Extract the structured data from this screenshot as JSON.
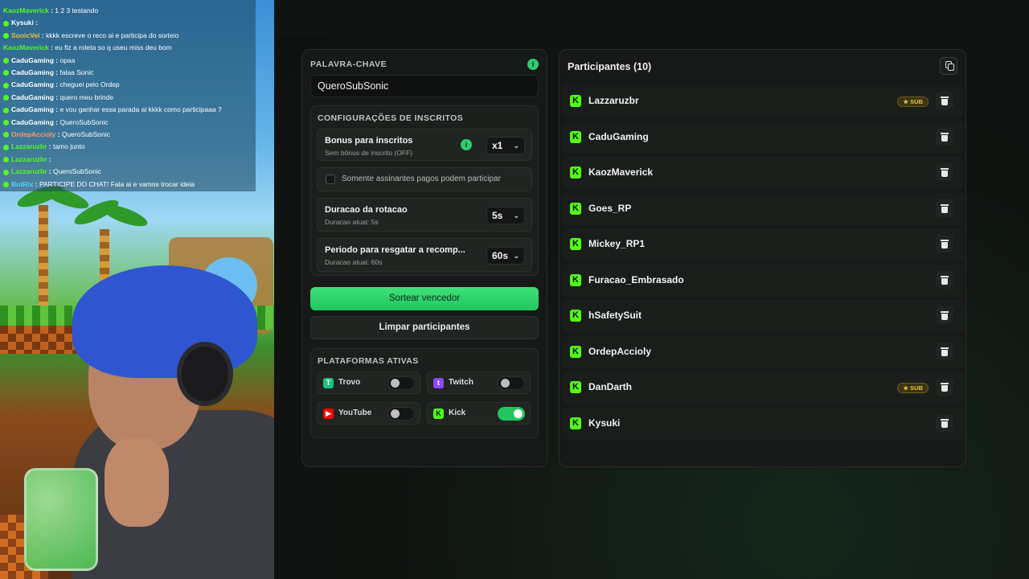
{
  "chat": {
    "lines": [
      {
        "user": "KaozMaverick",
        "message": "1 2 3 testando",
        "color": "#53fc18",
        "badge": false
      },
      {
        "user": "Kysuki",
        "message": "",
        "color": "#ffffff",
        "badge": true
      },
      {
        "user": "SonicVei",
        "message": "kkkk escreve o reco ai e participa do sorteio",
        "color": "#f1c232",
        "badge": true
      },
      {
        "user": "KaozMaverick",
        "message": "eu fiz a roleta so q useu miss deu bom",
        "color": "#53fc18",
        "badge": false
      },
      {
        "user": "CaduGaming",
        "message": "opaa",
        "color": "#ffffff",
        "badge": true
      },
      {
        "user": "CaduGaming",
        "message": "falaa Sonic",
        "color": "#ffffff",
        "badge": true
      },
      {
        "user": "CaduGaming",
        "message": "cheguei pelo Ordep",
        "color": "#ffffff",
        "badge": true
      },
      {
        "user": "CaduGaming",
        "message": "quero meu brinde",
        "color": "#ffffff",
        "badge": true
      },
      {
        "user": "CaduGaming",
        "message": "e vou ganhar essa parada ai kkkk como participaaa ?",
        "color": "#ffffff",
        "badge": true
      },
      {
        "user": "CaduGaming",
        "message": "QueroSubSonic",
        "color": "#ffffff",
        "badge": true
      },
      {
        "user": "OrdepAccioly",
        "message": "QueroSubSonic",
        "color": "#ff9a5a",
        "badge": true
      },
      {
        "user": "Lazzaruzbr",
        "message": "tamo junto",
        "color": "#53fc18",
        "badge": true
      },
      {
        "user": "Lazzaruzbr",
        "message": "",
        "color": "#53fc18",
        "badge": true
      },
      {
        "user": "Lazzaruzbr",
        "message": "QueroSubSonic",
        "color": "#53fc18",
        "badge": true
      },
      {
        "user": "BotRix",
        "message": "PARTICIPE DO CHAT! Fala ai e vamos trocar ideia",
        "color": "#5ad1ff",
        "badge": true
      }
    ]
  },
  "keyword": {
    "label": "PALAVRA-CHAVE",
    "value": "QueroSubSonic",
    "info": "i"
  },
  "config": {
    "title": "CONFIGURAÇÕES DE INSCRITOS",
    "bonus": {
      "title": "Bonus para inscritos",
      "subtitle": "Sem bônus de inscrito (OFF)",
      "value": "x1",
      "info": "i"
    },
    "paid_only": {
      "label": "Somente assinantes pagos podem participar",
      "checked": false
    },
    "rotation": {
      "title": "Duracao da rotacao",
      "subtitle": "Duracao atual: 5s",
      "value": "5s"
    },
    "claim": {
      "title": "Periodo para resgatar a recomp...",
      "subtitle": "Duracao atual: 60s",
      "value": "60s"
    }
  },
  "actions": {
    "draw": "Sortear vencedor",
    "clear": "Limpar participantes"
  },
  "platforms": {
    "title": "PLATAFORMAS ATIVAS",
    "items": [
      {
        "name": "Trovo",
        "icon": "trovo-icon",
        "color": "#1bc47d",
        "enabled": false
      },
      {
        "name": "Twitch",
        "icon": "twitch-icon",
        "color": "#9146ff",
        "enabled": false
      },
      {
        "name": "YouTube",
        "icon": "youtube-icon",
        "color": "#ff0000",
        "enabled": false
      },
      {
        "name": "Kick",
        "icon": "kick-icon",
        "color": "#53fc18",
        "enabled": true
      }
    ]
  },
  "participants": {
    "title": "Participantes (10)",
    "sub_label": "SUB",
    "list": [
      {
        "name": "Lazzaruzbr",
        "sub": true
      },
      {
        "name": "CaduGaming",
        "sub": false
      },
      {
        "name": "KaozMaverick",
        "sub": false
      },
      {
        "name": "Goes_RP",
        "sub": false
      },
      {
        "name": "Mickey_RP1",
        "sub": false
      },
      {
        "name": "Furacao_Embrasado",
        "sub": false
      },
      {
        "name": "hSafetySuit",
        "sub": false
      },
      {
        "name": "OrdepAccioly",
        "sub": false
      },
      {
        "name": "DanDarth",
        "sub": true
      },
      {
        "name": "Kysuki",
        "sub": false
      }
    ]
  },
  "colors": {
    "accent": "#22c55e",
    "kick": "#53fc18",
    "sub_gold": "#f1c232"
  }
}
